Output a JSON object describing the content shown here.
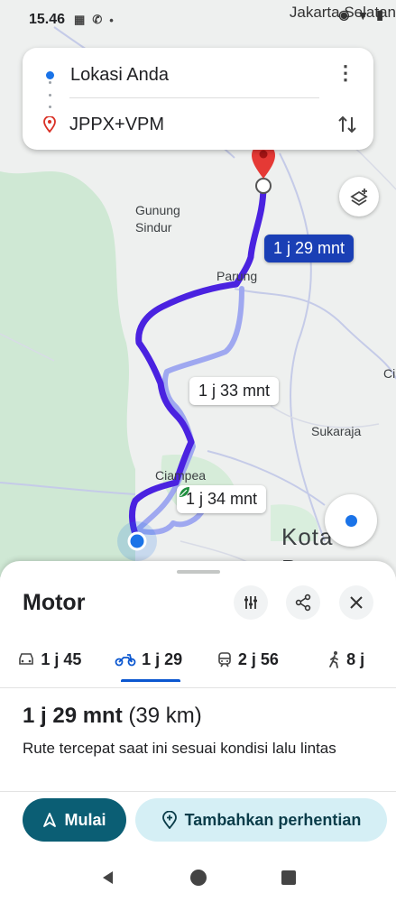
{
  "status_bar": {
    "time": "15.46",
    "city": "Jakarta Selatan"
  },
  "route_card": {
    "origin": "Lokasi Anda",
    "destination": "JPPX+VPM"
  },
  "map": {
    "labels": {
      "gunung_sindur": "Gunung\nSindur",
      "parung": "Parung",
      "sukaraja": "Sukaraja",
      "ciampea": "Ciampea",
      "kota_bogor": "Kota Bogor",
      "ci": "Ci"
    },
    "eta": {
      "primary": "1 j 29 mnt",
      "alt1": "1 j 33 mnt",
      "alt2": "1 j 34 mnt"
    },
    "colors": {
      "route_primary": "#4a22e0",
      "route_alt": "#9fa8f0",
      "forest": "#cfe8d4",
      "road": "#c5cbe8"
    }
  },
  "sheet": {
    "title": "Motor",
    "tabs": [
      {
        "icon": "car-icon",
        "label": "1 j 45"
      },
      {
        "icon": "motorcycle-icon",
        "label": "1 j 29"
      },
      {
        "icon": "train-icon",
        "label": "2 j 56"
      },
      {
        "icon": "walk-icon",
        "label": "8 j"
      }
    ],
    "duration_main": "1 j 29 mnt",
    "duration_distance": "(39 km)",
    "description": "Rute tercepat saat ini sesuai kondisi lalu lintas",
    "start_label": "Mulai",
    "add_stop_label": "Tambahkan perhentian"
  }
}
